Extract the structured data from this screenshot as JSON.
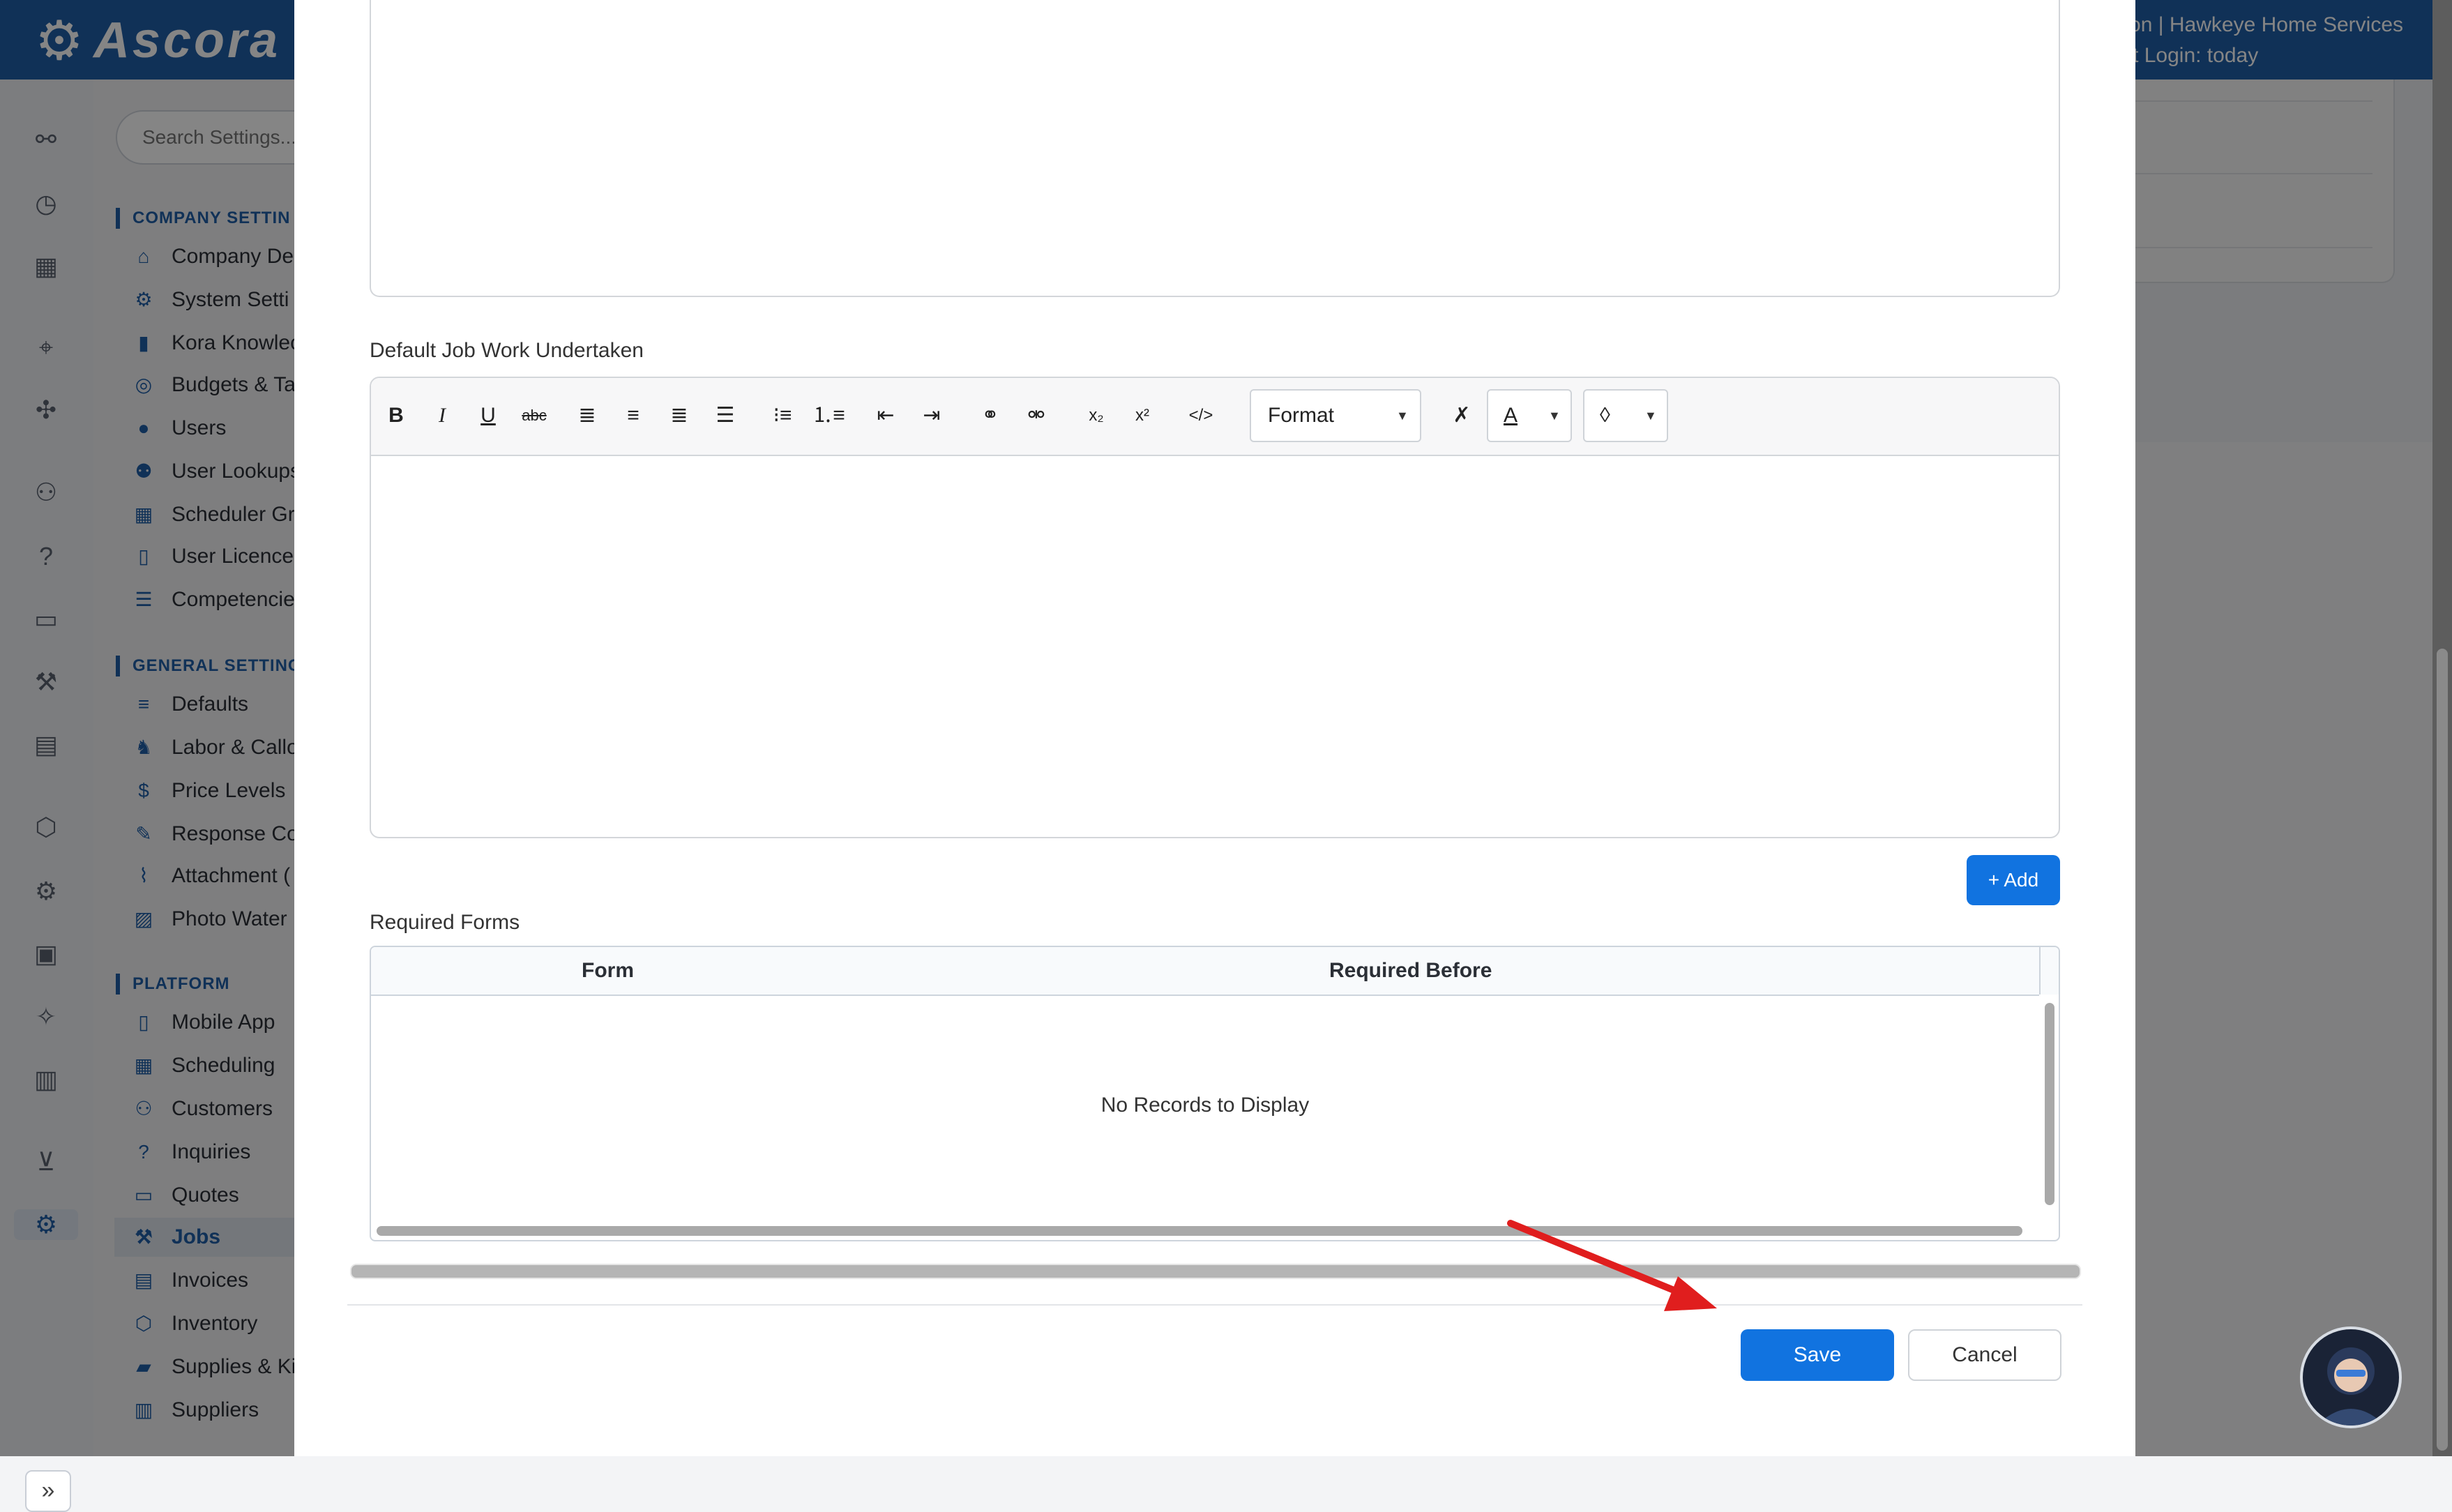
{
  "app": {
    "logo_text": "Ascora",
    "user_line1": "ron | Hawkeye Home Services",
    "user_line2": "st Login: today"
  },
  "search": {
    "placeholder": "Search Settings..."
  },
  "nav": {
    "company_section": "COMPANY SETTIN",
    "company_items": [
      "Company De",
      "System Setti",
      "Kora Knowlec",
      "Budgets & Ta",
      "Users",
      "User Lookups",
      "Scheduler Gr",
      "User Licence",
      "Competencie"
    ],
    "general_section": "GENERAL SETTING",
    "general_items": [
      "Defaults",
      "Labor & Callo",
      "Price Levels",
      "Response Co",
      "Attachment (",
      "Photo Water"
    ],
    "platform_section": "PLATFORM",
    "platform_items": [
      "Mobile App",
      "Scheduling",
      "Customers",
      "Inquiries",
      "Quotes",
      "Jobs",
      "Invoices",
      "Inventory",
      "Supplies & Ki",
      "Suppliers"
    ],
    "active_item": "Jobs"
  },
  "rail_icons": [
    "workflow-icon",
    "gauge-icon",
    "calendar-icon",
    "location-pin-icon",
    "puzzle-icon",
    "people-icon",
    "help-icon",
    "briefcase-icon",
    "wrench-icon",
    "document-icon",
    "cubes-icon",
    "gear-icon",
    "contact-card-icon",
    "magic-wand-icon",
    "bar-chart-icon",
    "cart-icon",
    "settings-gears-icon"
  ],
  "modal": {
    "work_undertaken_label": "Default Job Work Undertaken",
    "format_label": "Format",
    "add_button": "+ Add",
    "required_forms_label": "Required Forms",
    "grid": {
      "columns": [
        "Form",
        "Required Before"
      ],
      "empty_text": "No Records to Display"
    },
    "save_button": "Save",
    "cancel_button": "Cancel"
  },
  "toolbar_icons": [
    "bold-icon",
    "italic-icon",
    "underline-icon",
    "strikethrough-icon",
    "align-left-icon",
    "align-center-icon",
    "align-right-icon",
    "align-justify-icon",
    "bullet-list-icon",
    "numbered-list-icon",
    "outdent-icon",
    "indent-icon",
    "link-icon",
    "unlink-icon",
    "subscript-icon",
    "superscript-icon",
    "code-view-icon",
    "format-select",
    "clear-format-icon",
    "font-color-icon",
    "background-color-icon"
  ],
  "colors": {
    "brand_blue": "#1f5ea8",
    "button_blue": "#1173e0",
    "annotation_red": "#e01e1e"
  }
}
